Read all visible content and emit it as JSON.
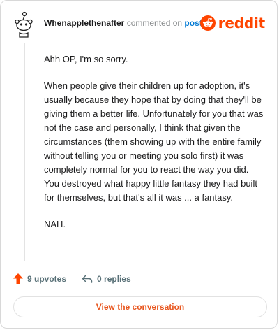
{
  "comment": {
    "username": "Whenapplethenafter",
    "action_text": "commented on",
    "post_link": "post",
    "brand": "reddit",
    "paragraphs": [
      "Ahh OP, I'm so sorry.",
      "When people give their children up for adoption, it's usually because they hope that by doing that they'll be giving them a better life. Unfortunately for you that was not the case and personally, I think that given the circumstances (them showing up with the entire family without telling you or meeting you solo first) it was completely normal for you to react the way you did. You destroyed what happy little fantasy they had built for themselves, but that's all it was ... a fantasy.",
      "NAH."
    ]
  },
  "actions": {
    "upvotes_label": "9 upvotes",
    "replies_label": "0 replies"
  },
  "cta": {
    "label": "View the conversation"
  },
  "colors": {
    "brand": "#ff4500",
    "link": "#0079d3",
    "cta_text": "#e8551d"
  },
  "icons": [
    "snoo-avatar-icon",
    "reddit-logo-icon",
    "upvote-arrow-icon",
    "reply-arrow-icon"
  ]
}
